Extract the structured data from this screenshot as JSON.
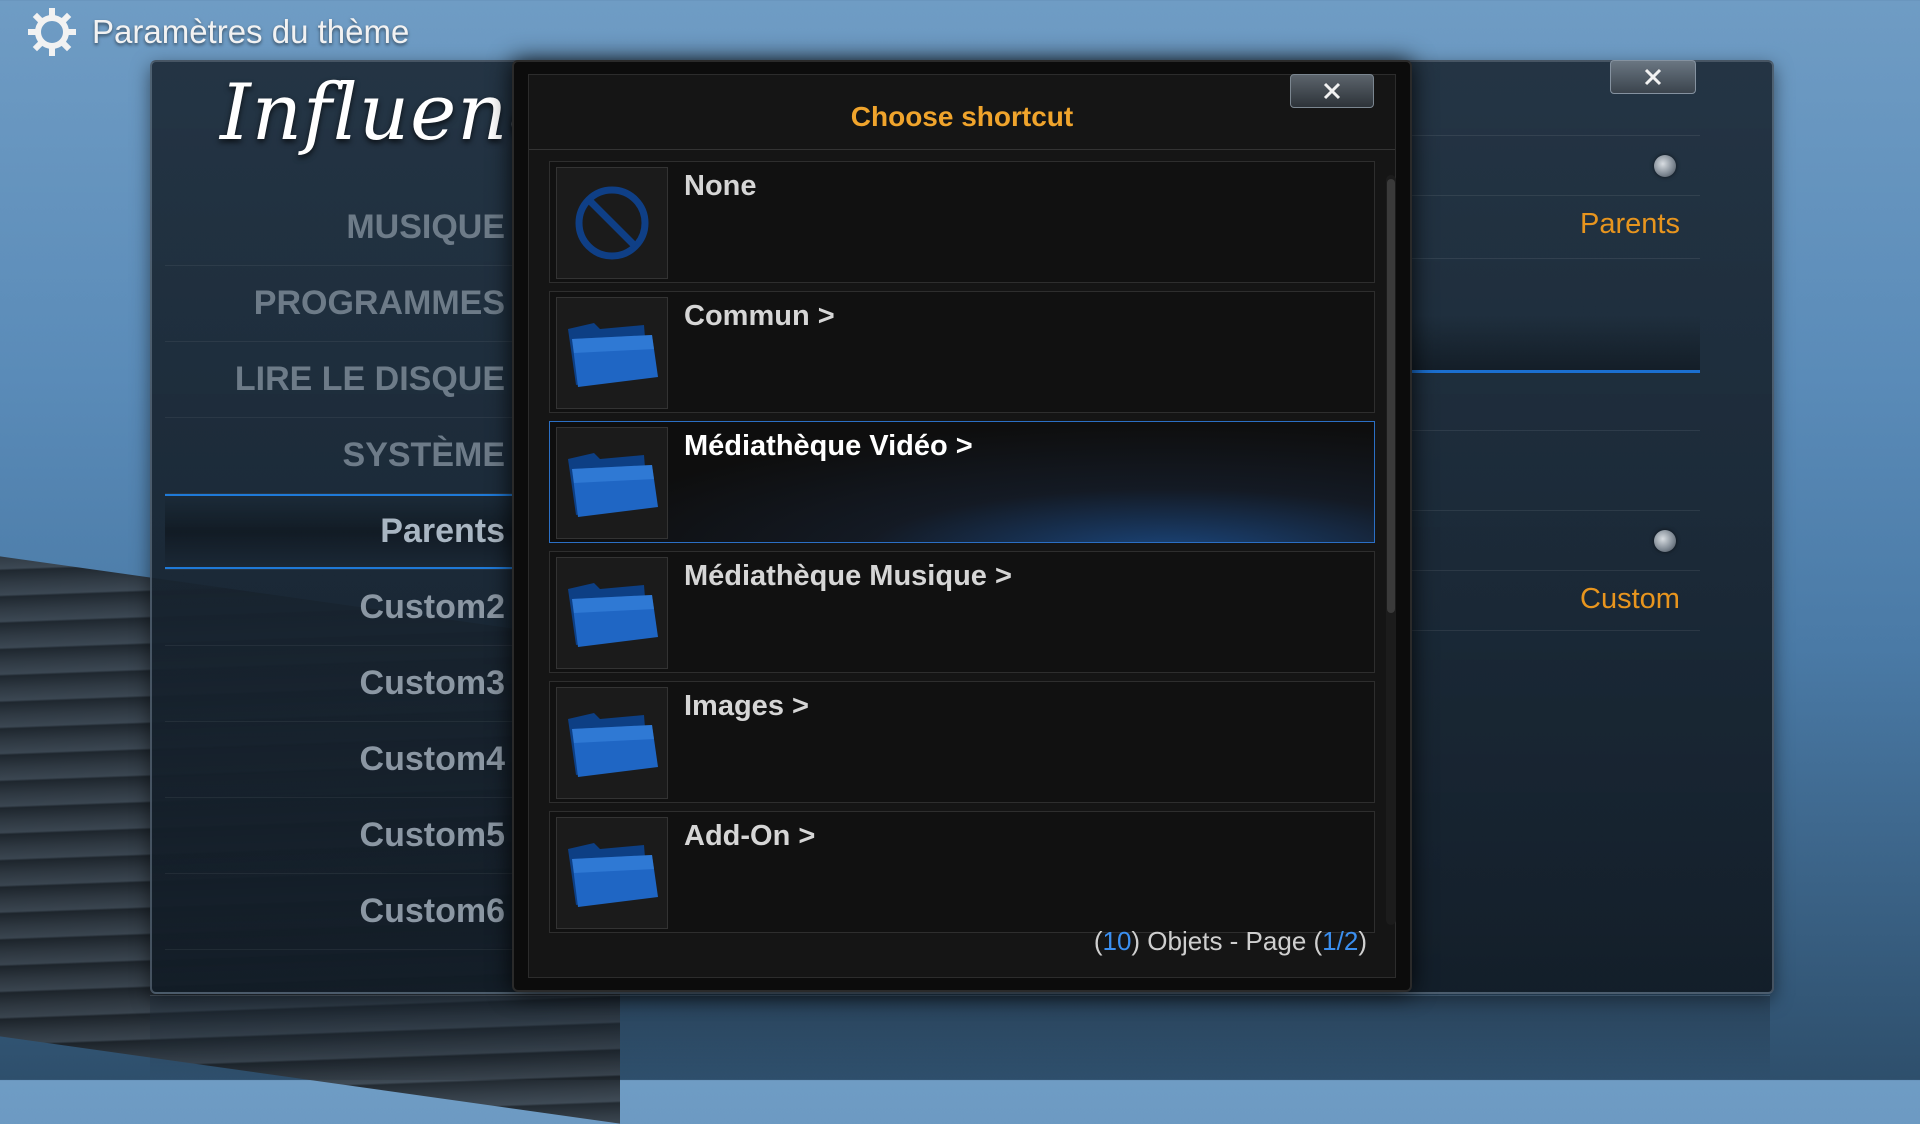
{
  "header": {
    "title": "Paramètres du thème",
    "icon": "gear-icon"
  },
  "logo": {
    "text": "Influence"
  },
  "nav": {
    "items": [
      {
        "label": "MUSIQUE"
      },
      {
        "label": "PROGRAMMES"
      },
      {
        "label": "LIRE LE DISQUE"
      },
      {
        "label": "SYSTÈME"
      },
      {
        "label": "Parents"
      },
      {
        "label": "Custom2"
      },
      {
        "label": "Custom3"
      },
      {
        "label": "Custom4"
      },
      {
        "label": "Custom5"
      },
      {
        "label": "Custom6"
      }
    ],
    "active_index": 4
  },
  "right_panel": {
    "value_1": "Parents",
    "value_2": "Custom"
  },
  "dialog": {
    "title": "Choose shortcut",
    "items": [
      {
        "label": "None",
        "icon": "no-entry-icon"
      },
      {
        "label": "Commun  >",
        "icon": "folder-icon"
      },
      {
        "label": "Médiathèque Vidéo  >",
        "icon": "folder-icon",
        "selected": true
      },
      {
        "label": "Médiathèque Musique  >",
        "icon": "folder-icon"
      },
      {
        "label": "Images  >",
        "icon": "folder-icon"
      },
      {
        "label": "Add-On  >",
        "icon": "folder-icon"
      }
    ],
    "footer": {
      "open": "(",
      "count": "10",
      "objects_text": ") Objets - Page (",
      "page": "1",
      "sep": "/",
      "pages": "2",
      "close": ")"
    }
  },
  "colors": {
    "accent": "#f0a42c",
    "selection": "#2b6fc4",
    "folder": "#1f5fb8"
  }
}
